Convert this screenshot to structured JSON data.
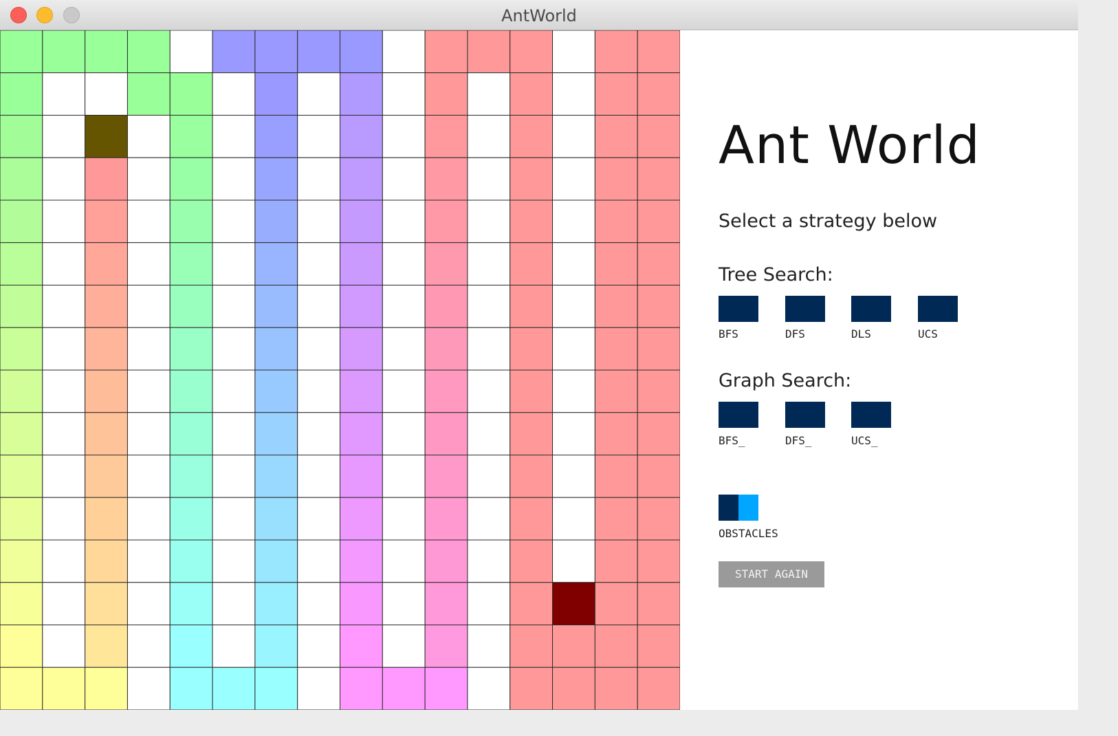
{
  "window": {
    "title": "AntWorld"
  },
  "panel": {
    "heading": "Ant World",
    "subtitle": "Select a strategy below",
    "tree_label": "Tree Search:",
    "tree_buttons": [
      "BFS",
      "DFS",
      "DLS",
      "UCS"
    ],
    "graph_label": "Graph Search:",
    "graph_buttons": [
      "BFS_",
      "DFS_",
      "UCS_"
    ],
    "obstacles_label": "OBSTACLES",
    "start_label": "START AGAIN"
  },
  "colors": {
    "button": "#002a55",
    "toggle_on": "#00a6ff",
    "start_button": "#9a9a9a",
    "grid_line": "#2a2a2a",
    "empty_cell": "#ffffff",
    "start_cell": "#665500",
    "goal_cell": "#800000"
  },
  "grid": {
    "rows": 16,
    "cols": 16,
    "empty_cells": [
      [
        0,
        4
      ],
      [
        0,
        9
      ],
      [
        0,
        13
      ],
      [
        1,
        1
      ],
      [
        1,
        2
      ],
      [
        1,
        5
      ],
      [
        1,
        7
      ],
      [
        1,
        9
      ],
      [
        1,
        11
      ],
      [
        1,
        13
      ],
      [
        2,
        1
      ],
      [
        2,
        3
      ],
      [
        2,
        5
      ],
      [
        2,
        7
      ],
      [
        2,
        9
      ],
      [
        2,
        11
      ],
      [
        2,
        13
      ],
      [
        3,
        1
      ],
      [
        3,
        3
      ],
      [
        3,
        5
      ],
      [
        3,
        7
      ],
      [
        3,
        9
      ],
      [
        3,
        11
      ],
      [
        3,
        13
      ],
      [
        4,
        1
      ],
      [
        4,
        3
      ],
      [
        4,
        5
      ],
      [
        4,
        7
      ],
      [
        4,
        9
      ],
      [
        4,
        11
      ],
      [
        4,
        13
      ],
      [
        5,
        1
      ],
      [
        5,
        3
      ],
      [
        5,
        5
      ],
      [
        5,
        7
      ],
      [
        5,
        9
      ],
      [
        5,
        11
      ],
      [
        5,
        13
      ],
      [
        6,
        1
      ],
      [
        6,
        3
      ],
      [
        6,
        5
      ],
      [
        6,
        7
      ],
      [
        6,
        9
      ],
      [
        6,
        11
      ],
      [
        6,
        13
      ],
      [
        7,
        1
      ],
      [
        7,
        3
      ],
      [
        7,
        5
      ],
      [
        7,
        7
      ],
      [
        7,
        9
      ],
      [
        7,
        11
      ],
      [
        7,
        13
      ],
      [
        8,
        1
      ],
      [
        8,
        3
      ],
      [
        8,
        5
      ],
      [
        8,
        7
      ],
      [
        8,
        9
      ],
      [
        8,
        11
      ],
      [
        8,
        13
      ],
      [
        9,
        1
      ],
      [
        9,
        3
      ],
      [
        9,
        5
      ],
      [
        9,
        7
      ],
      [
        9,
        9
      ],
      [
        9,
        11
      ],
      [
        9,
        13
      ],
      [
        10,
        1
      ],
      [
        10,
        3
      ],
      [
        10,
        5
      ],
      [
        10,
        7
      ],
      [
        10,
        9
      ],
      [
        10,
        11
      ],
      [
        10,
        13
      ],
      [
        11,
        1
      ],
      [
        11,
        3
      ],
      [
        11,
        5
      ],
      [
        11,
        7
      ],
      [
        11,
        9
      ],
      [
        11,
        11
      ],
      [
        11,
        13
      ],
      [
        12,
        1
      ],
      [
        12,
        3
      ],
      [
        12,
        5
      ],
      [
        12,
        7
      ],
      [
        12,
        9
      ],
      [
        12,
        11
      ],
      [
        12,
        13
      ],
      [
        13,
        1
      ],
      [
        13,
        3
      ],
      [
        13,
        5
      ],
      [
        13,
        7
      ],
      [
        13,
        9
      ],
      [
        13,
        11
      ],
      [
        14,
        1
      ],
      [
        14,
        3
      ],
      [
        14,
        5
      ],
      [
        14,
        7
      ],
      [
        14,
        9
      ],
      [
        14,
        11
      ],
      [
        15,
        3
      ],
      [
        15,
        7
      ],
      [
        15,
        11
      ]
    ],
    "start_cell": [
      2,
      2
    ],
    "goal_cell": [
      13,
      13
    ],
    "explored_fixed": [
      {
        "cells": [
          [
            0,
            0
          ],
          [
            0,
            1
          ],
          [
            0,
            2
          ],
          [
            0,
            3
          ],
          [
            1,
            0
          ],
          [
            1,
            3
          ],
          [
            1,
            4
          ]
        ],
        "color": "#99ff99"
      },
      {
        "cells": [
          [
            0,
            5
          ],
          [
            0,
            6
          ],
          [
            0,
            7
          ],
          [
            0,
            8
          ],
          [
            1,
            6
          ]
        ],
        "color": "#9999ff"
      },
      {
        "cells": [
          [
            1,
            8
          ]
        ],
        "color": "#b09aff"
      },
      {
        "cells": [
          [
            0,
            10
          ],
          [
            0,
            11
          ],
          [
            0,
            12
          ],
          [
            0,
            14
          ],
          [
            0,
            15
          ],
          [
            1,
            10
          ],
          [
            1,
            12
          ],
          [
            1,
            14
          ],
          [
            1,
            15
          ]
        ],
        "color": "#ff9999"
      },
      {
        "cells": [
          [
            15,
            0
          ],
          [
            15,
            1
          ],
          [
            15,
            2
          ]
        ],
        "color": "#ffff99"
      },
      {
        "cells": [
          [
            15,
            4
          ],
          [
            15,
            5
          ],
          [
            15,
            6
          ]
        ],
        "color": "#99ffff"
      },
      {
        "cells": [
          [
            15,
            8
          ],
          [
            15,
            9
          ],
          [
            15,
            10
          ]
        ],
        "color": "#ff99ff"
      }
    ],
    "explored_gradients": [
      {
        "col": 0,
        "from_row": 2,
        "to_row": 14,
        "from_color": "#a2fd99",
        "to_color": "#ffff99"
      },
      {
        "col": 2,
        "from_row": 3,
        "to_row": 14,
        "from_color": "#ff9999",
        "to_color": "#ffe699"
      },
      {
        "col": 4,
        "from_row": 2,
        "to_row": 14,
        "from_color": "#99ff9f",
        "to_color": "#99ffff"
      },
      {
        "col": 6,
        "from_row": 2,
        "to_row": 14,
        "from_color": "#999fff",
        "to_color": "#99f5ff"
      },
      {
        "col": 8,
        "from_row": 2,
        "to_row": 14,
        "from_color": "#b99aff",
        "to_color": "#ff99ff"
      },
      {
        "col": 10,
        "from_row": 2,
        "to_row": 14,
        "from_color": "#ff999d",
        "to_color": "#ff99e0"
      },
      {
        "col": 12,
        "from_row": 1,
        "to_row": 15,
        "from_color": "#ff9999",
        "to_color": "#ff9999"
      },
      {
        "col": 13,
        "from_row": 14,
        "to_row": 15,
        "from_color": "#ff9999",
        "to_color": "#ff9999"
      },
      {
        "col": 14,
        "from_row": 2,
        "to_row": 15,
        "from_color": "#ff9999",
        "to_color": "#ff9999"
      },
      {
        "col": 15,
        "from_row": 2,
        "to_row": 15,
        "from_color": "#ff9999",
        "to_color": "#ff9999"
      }
    ]
  }
}
